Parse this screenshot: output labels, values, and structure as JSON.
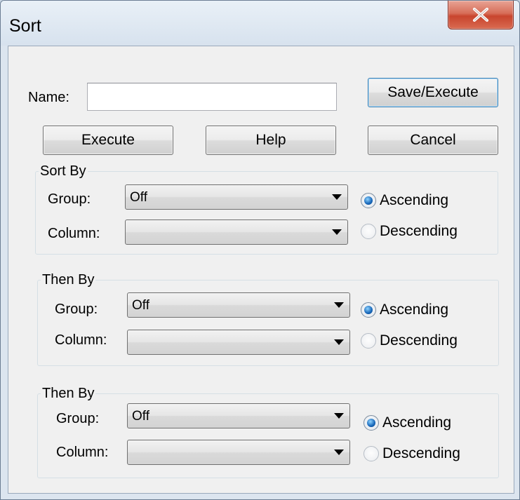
{
  "window": {
    "title": "Sort",
    "close_symbol": "X"
  },
  "name_field": {
    "label": "Name:",
    "value": "",
    "placeholder": ""
  },
  "buttons": {
    "save_execute": "Save/Execute",
    "execute": "Execute",
    "help": "Help",
    "cancel": "Cancel"
  },
  "groups": [
    {
      "legend": "Sort By",
      "group_label": "Group:",
      "group_value": "Off",
      "column_label": "Column:",
      "column_value": "",
      "ascending_label": "Ascending",
      "descending_label": "Descending",
      "selected": "ascending"
    },
    {
      "legend": "Then By",
      "group_label": "Group:",
      "group_value": "Off",
      "column_label": "Column:",
      "column_value": "",
      "ascending_label": "Ascending",
      "descending_label": "Descending",
      "selected": "ascending"
    },
    {
      "legend": "Then By",
      "group_label": "Group:",
      "group_value": "Off",
      "column_label": "Column:",
      "column_value": "",
      "ascending_label": "Ascending",
      "descending_label": "Descending",
      "selected": "ascending"
    }
  ],
  "colors": {
    "close_button": "#c8452e",
    "radio_selected": "#1565b8",
    "default_button_border": "#3c7fb1"
  },
  "icons": {
    "close": "close-icon",
    "dropdown": "chevron-down-icon"
  }
}
